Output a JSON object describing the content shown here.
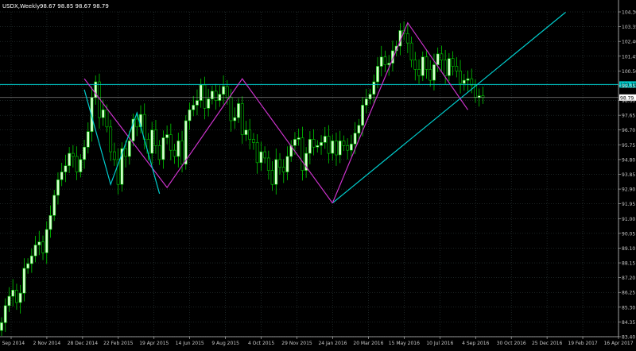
{
  "header": {
    "symbol_label": "USDX,Weekly",
    "ohlc_text": "98.67 98.85 98.67 98.79"
  },
  "colors": {
    "background": "#000000",
    "grid": "#3a4a4a",
    "axis": "#c8c8c8",
    "bull": "#d8ffd0",
    "bear": "#00cc00",
    "wick": "#00cc00",
    "pattern": "#cc33cc",
    "trend": "#00cccc",
    "hline": "#00cccc",
    "price_line": "#c0c0c0",
    "label_text": "#ffffff"
  },
  "chart_data": {
    "type": "candlestick",
    "title": "USDX,Weekly",
    "grid": true,
    "ylim": [
      83.4,
      104.3
    ],
    "y_ticks": [
      "104.30",
      "103.35",
      "102.40",
      "101.45",
      "100.50",
      "99.55",
      "98.60",
      "97.65",
      "96.70",
      "95.75",
      "94.80",
      "93.85",
      "92.90",
      "91.95",
      "91.00",
      "90.05",
      "89.10",
      "88.15",
      "87.20",
      "86.25",
      "85.30",
      "84.35",
      "83.40"
    ],
    "x_ticks": [
      "7 Sep 2014",
      "2 Nov 2014",
      "28 Dec 2014",
      "22 Feb 2015",
      "19 Apr 2015",
      "14 Jun 2015",
      "9 Aug 2015",
      "4 Oct 2015",
      "29 Nov 2015",
      "24 Jan 2016",
      "20 Mar 2016",
      "15 May 2016",
      "10 Jul 2016",
      "4 Sep 2016",
      "30 Oct 2016",
      "25 Dec 2016",
      "19 Feb 2017",
      "16 Apr 2017"
    ],
    "closes": [
      84.3,
      85.4,
      86.0,
      86.4,
      85.6,
      86.2,
      87.8,
      88.1,
      88.6,
      89.3,
      89.5,
      88.8,
      90.3,
      91.2,
      92.5,
      93.5,
      94.0,
      94.4,
      95.2,
      95.0,
      94.0,
      94.8,
      95.6,
      96.6,
      98.8,
      99.8,
      97.5,
      98.0,
      96.9,
      95.3,
      94.8,
      93.2,
      95.5,
      95.0,
      96.0,
      97.4,
      96.9,
      97.7,
      96.1,
      95.2,
      96.7,
      95.7,
      94.8,
      96.2,
      96.4,
      95.4,
      95.0,
      96.0,
      94.5,
      97.3,
      98.0,
      98.3,
      98.6,
      99.6,
      98.1,
      98.7,
      99.2,
      98.6,
      99.0,
      99.5,
      98.8,
      97.3,
      97.5,
      98.4,
      96.4,
      96.7,
      96.1,
      95.9,
      94.6,
      95.3,
      94.9,
      94.1,
      93.2,
      94.8,
      94.3,
      94.0,
      95.0,
      95.7,
      96.1,
      96.2,
      94.1,
      95.2,
      96.1,
      95.6,
      95.7,
      95.9,
      96.3,
      95.2,
      96.0,
      95.1,
      96.0,
      95.7,
      95.4,
      95.8,
      96.5,
      97.0,
      98.3,
      98.7,
      99.0,
      99.8,
      100.8,
      101.4,
      100.9,
      101.0,
      101.8,
      102.1,
      103.1,
      102.9,
      102.3,
      101.2,
      100.6,
      100.2,
      101.4,
      100.6,
      99.9,
      100.9,
      101.6,
      101.2,
      100.2,
      101.3,
      100.8,
      100.5,
      99.7,
      99.9,
      100.0,
      99.6,
      98.8,
      98.9,
      98.79
    ],
    "pattern_lines": [
      {
        "name": "magenta-double-top-1",
        "points": [
          [
            22,
            100.0
          ],
          [
            44,
            93.0
          ],
          [
            64,
            100.0
          ],
          [
            88,
            92.0
          ]
        ]
      },
      {
        "name": "cyan-zigzag-1",
        "points": [
          [
            22,
            99.3
          ],
          [
            29,
            93.2
          ],
          [
            36,
            97.8
          ],
          [
            42,
            92.6
          ]
        ]
      },
      {
        "name": "magenta-double-top-2",
        "points": [
          [
            88,
            92.0
          ],
          [
            108,
            103.6
          ],
          [
            124,
            98.0
          ]
        ]
      }
    ],
    "trendline": {
      "from": [
        88,
        92.0
      ],
      "to": [
        140,
        102.3
      ]
    },
    "hline": {
      "value": 99.63,
      "label": "100.19"
    },
    "price_label": {
      "value": 98.79,
      "label": "98.79"
    }
  }
}
